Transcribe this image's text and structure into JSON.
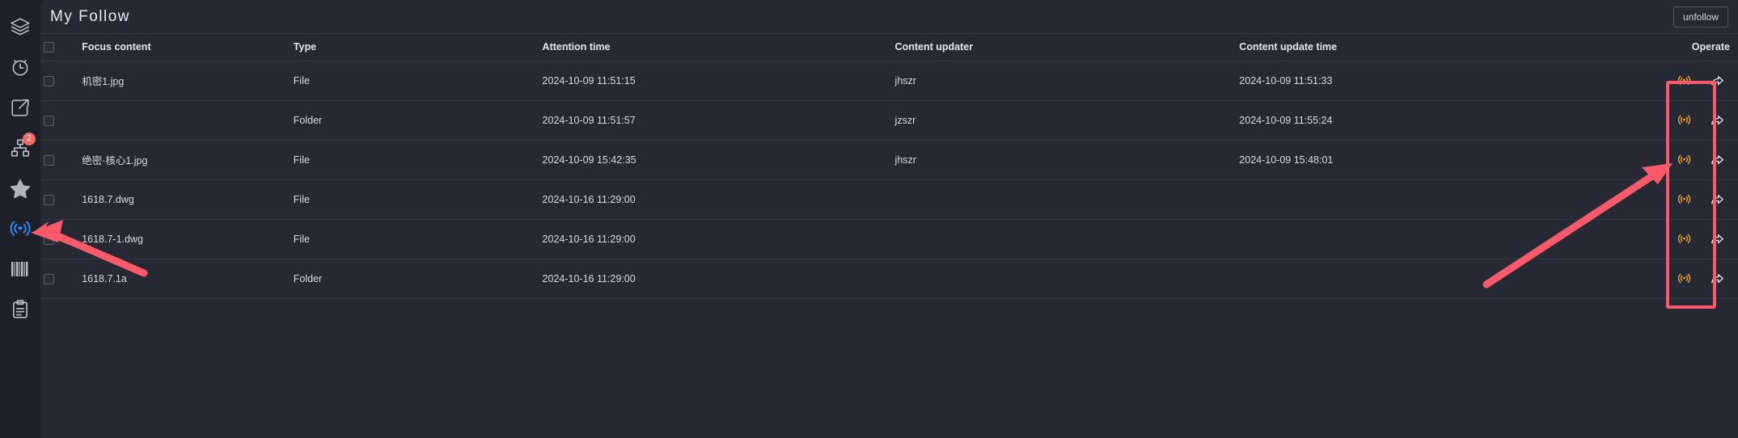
{
  "sidebar": {
    "items": [
      {
        "name": "layers-icon",
        "label": "Layers",
        "badge": null,
        "active": false
      },
      {
        "name": "clock-icon",
        "label": "Recent",
        "badge": null,
        "active": false
      },
      {
        "name": "share-out-icon",
        "label": "Share",
        "badge": null,
        "active": false
      },
      {
        "name": "org-tree-icon",
        "label": "Workflow",
        "badge": "2",
        "active": false
      },
      {
        "name": "star-icon",
        "label": "Favorites",
        "badge": null,
        "active": false
      },
      {
        "name": "broadcast-icon",
        "label": "My Follow",
        "badge": null,
        "active": true
      },
      {
        "name": "barcode-icon",
        "label": "Barcode",
        "badge": null,
        "active": false
      },
      {
        "name": "clipboard-icon",
        "label": "Log",
        "badge": null,
        "active": false
      }
    ]
  },
  "header": {
    "title": "My Follow",
    "unfollow_label": "unfollow"
  },
  "table": {
    "columns": [
      "Focus content",
      "Type",
      "Attention time",
      "Content updater",
      "Content update time",
      "Operate"
    ],
    "rows": [
      {
        "focus_content": "机密1.jpg",
        "type": "File",
        "attention_time": "2024-10-09 11:51:15",
        "content_updater": "jhszr",
        "content_update_time": "2024-10-09 11:51:33"
      },
      {
        "focus_content": "",
        "type": "Folder",
        "attention_time": "2024-10-09 11:51:57",
        "content_updater": "jzszr",
        "content_update_time": "2024-10-09 11:55:24"
      },
      {
        "focus_content": "绝密·核心1.jpg",
        "type": "File",
        "attention_time": "2024-10-09 15:42:35",
        "content_updater": "jhszr",
        "content_update_time": "2024-10-09 15:48:01"
      },
      {
        "focus_content": "1618.7.dwg",
        "type": "File",
        "attention_time": "2024-10-16 11:29:00",
        "content_updater": "",
        "content_update_time": ""
      },
      {
        "focus_content": "1618.7-1.dwg",
        "type": "File",
        "attention_time": "2024-10-16 11:29:00",
        "content_updater": "",
        "content_update_time": ""
      },
      {
        "focus_content": "1618.7.1a",
        "type": "Folder",
        "attention_time": "2024-10-16 11:29:00",
        "content_updater": "",
        "content_update_time": ""
      }
    ],
    "operate_icons": [
      "broadcast-icon",
      "share-icon"
    ]
  },
  "colors": {
    "app_background": "#1b1d26",
    "sidebar_background": "#1e2029",
    "panel_background": "#262933",
    "row_divider": "#34373f",
    "text_primary": "#e3e6ec",
    "text_secondary": "#d7dae1",
    "accent_active": "#3d8bff",
    "badge": "#ef6b64",
    "operate_follow_icon": "#f0a020",
    "annotation_red": "#fb5a6a"
  },
  "annotations": {
    "highlight_box_label": "operate-follow-column-highlight",
    "arrow_to_sidebar_label": "arrow-pointing-to-follow-nav",
    "arrow_to_operate_label": "arrow-pointing-to-follow-action"
  }
}
